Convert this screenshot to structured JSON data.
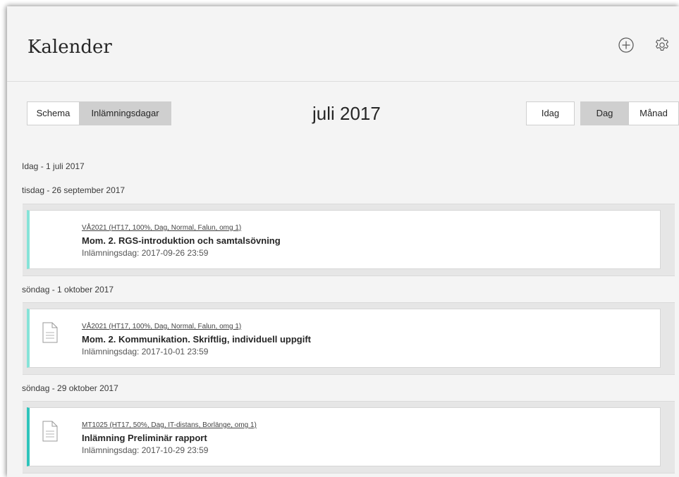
{
  "header": {
    "title": "Kalender",
    "icons": {
      "add": "add-circle-icon",
      "settings": "gear-icon"
    }
  },
  "toolbar": {
    "view_tabs": [
      {
        "label": "Schema",
        "active": false
      },
      {
        "label": "Inlämningsdagar",
        "active": true
      }
    ],
    "month_label": "juli 2017",
    "today_label": "Idag",
    "range_tabs": [
      {
        "label": "Dag",
        "active": true
      },
      {
        "label": "Månad",
        "active": false
      }
    ]
  },
  "today_heading": "Idag - 1 juli 2017",
  "days": [
    {
      "date_label": "tisdag - 26 september 2017",
      "item": {
        "course": "VÅ2021 (HT17, 100%, Dag, Normal, Falun, omg 1)",
        "title": "Mom. 2. RGS-introduktion och samtalsövning",
        "due": "Inlämningsdag: 2017-09-26 23:59",
        "has_icon": false,
        "accent": "#86e3d8"
      }
    },
    {
      "date_label": "söndag - 1 oktober 2017",
      "item": {
        "course": "VÅ2021 (HT17, 100%, Dag, Normal, Falun, omg 1)",
        "title": "Mom. 2. Kommunikation. Skriftlig, individuell uppgift",
        "due": "Inlämningsdag: 2017-10-01 23:59",
        "has_icon": true,
        "icon": "document-icon",
        "accent": "#86e3d8"
      }
    },
    {
      "date_label": "söndag - 29 oktober 2017",
      "item": {
        "course": "MT1025 (HT17, 50%, Dag, IT-distans, Borlänge, omg 1)",
        "title": "Inlämning Preliminär rapport",
        "due": "Inlämningsdag: 2017-10-29 23:59",
        "has_icon": true,
        "icon": "document-icon",
        "accent": "#2ec4bb"
      }
    }
  ]
}
